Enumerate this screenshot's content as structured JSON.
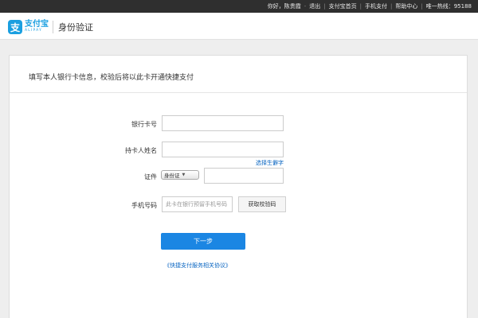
{
  "topbar": {
    "greeting": "你好，陈贵霞",
    "logout": "退出",
    "links": [
      "支付宝首页",
      "手机支付",
      "帮助中心"
    ],
    "hotline": "唯一热线：95188"
  },
  "header": {
    "logo_cn": "支付宝",
    "logo_en": "ALIPAY",
    "title": "身份验证"
  },
  "panel": {
    "title": "填写本人银行卡信息，校验后将以此卡开通快捷支付"
  },
  "form": {
    "card_label": "银行卡号",
    "card_value": "",
    "name_label": "持卡人姓名",
    "name_value": "",
    "rare_char_link": "选择生僻字",
    "id_label": "证件",
    "id_type": "身份证",
    "id_value": "",
    "phone_label": "手机号码",
    "phone_placeholder": "此卡在银行预留手机号码",
    "get_code_button": "获取校验码",
    "next_button": "下一步",
    "agreement_link": "《快捷支付服务相关协议》"
  }
}
